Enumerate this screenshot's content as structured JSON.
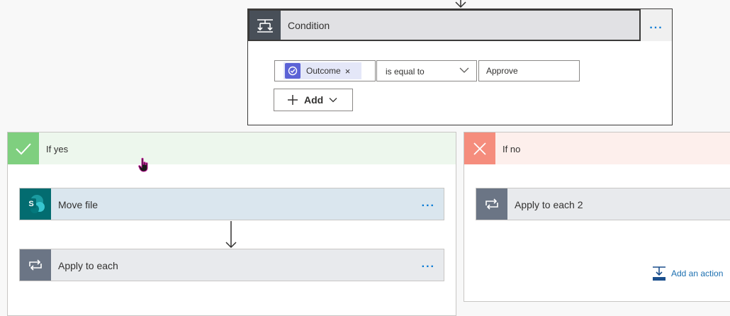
{
  "condition": {
    "title": "Condition",
    "more_label": "...",
    "token_label": "Outcome",
    "token_remove": "×",
    "operator": "is equal to",
    "value": "Approve",
    "add_label": "Add"
  },
  "branches": {
    "yes": {
      "label": "If yes",
      "actions": [
        {
          "title": "Move file",
          "more_label": "..."
        },
        {
          "title": "Apply to each",
          "more_label": "..."
        }
      ]
    },
    "no": {
      "label": "If no",
      "actions": [
        {
          "title": "Apply to each 2"
        }
      ],
      "add_action_label": "Add an action"
    }
  },
  "icons": {
    "condition": "condition-icon",
    "outcome": "approval-icon",
    "sharepoint": "sharepoint-icon",
    "loop": "loop-icon",
    "check": "check-icon",
    "close": "close-icon",
    "add_action": "add-action-icon"
  },
  "colors": {
    "accent": "#0078d4",
    "yes": "#7fcf7f",
    "no": "#f58d7d",
    "sharepoint": "#036c70",
    "loop": "#6b7585",
    "condition": "#484f58"
  }
}
